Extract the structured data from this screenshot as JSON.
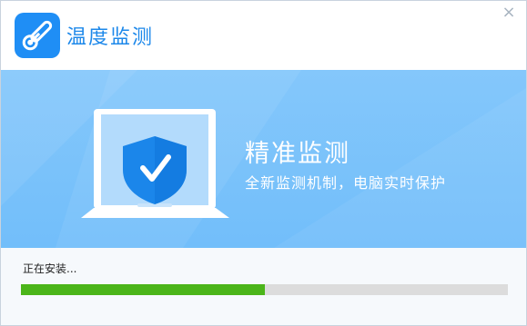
{
  "window": {
    "title": "温度监测",
    "close_glyph": "×"
  },
  "banner": {
    "heading": "精准监测",
    "subheading": "全新监测机制，电脑实时保护",
    "illustration": "laptop-shield-check-icon"
  },
  "install": {
    "status_text": "正在安装...",
    "progress_fraction": 0.5
  },
  "colors": {
    "accent": "#1d88ea",
    "banner_bg": "#7cc3fb",
    "progress_fill": "#4bb51a",
    "progress_track": "#dcdcdc"
  }
}
